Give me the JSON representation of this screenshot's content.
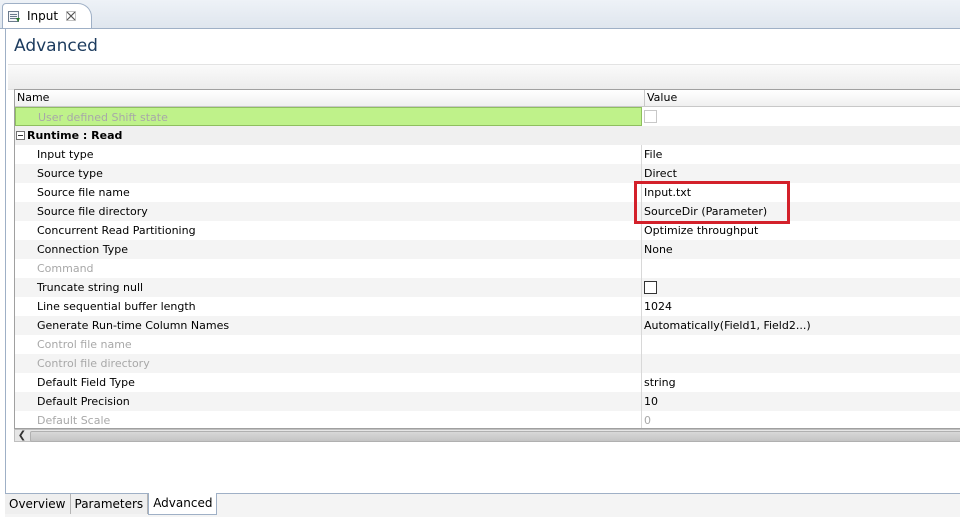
{
  "tab": {
    "label": "Input"
  },
  "page_title": "Advanced",
  "table": {
    "headers": {
      "name": "Name",
      "value": "Value"
    },
    "rows": [
      {
        "kind": "property",
        "name": "User defined Shift state",
        "value": "",
        "checkbox": true,
        "checked": false,
        "disabled": true,
        "highlight": true
      },
      {
        "kind": "category",
        "name": "Runtime : Read"
      },
      {
        "kind": "property",
        "name": "Input type",
        "value": "File"
      },
      {
        "kind": "property",
        "name": "Source type",
        "value": "Direct"
      },
      {
        "kind": "property",
        "name": "Source file name",
        "value": "Input.txt"
      },
      {
        "kind": "property",
        "name": "Source file directory",
        "value": "SourceDir (Parameter)"
      },
      {
        "kind": "property",
        "name": "Concurrent Read Partitioning",
        "value": "Optimize throughput"
      },
      {
        "kind": "property",
        "name": "Connection Type",
        "value": "None"
      },
      {
        "kind": "property",
        "name": "Command",
        "value": "",
        "disabled": true
      },
      {
        "kind": "property",
        "name": "Truncate string null",
        "value": "",
        "checkbox": true,
        "checked": false
      },
      {
        "kind": "property",
        "name": "Line sequential buffer length",
        "value": "1024"
      },
      {
        "kind": "property",
        "name": "Generate Run-time Column Names",
        "value": "Automatically(Field1, Field2...)"
      },
      {
        "kind": "property",
        "name": "Control file name",
        "value": "",
        "disabled": true
      },
      {
        "kind": "property",
        "name": "Control file directory",
        "value": "",
        "disabled": true
      },
      {
        "kind": "property",
        "name": "Default Field Type",
        "value": "string"
      },
      {
        "kind": "property",
        "name": "Default Precision",
        "value": "10"
      },
      {
        "kind": "property",
        "name": "Default Scale",
        "value": "0",
        "disabled": true
      }
    ]
  },
  "bottom_tabs": [
    {
      "label": "Overview",
      "active": false
    },
    {
      "label": "Parameters",
      "active": false
    },
    {
      "label": "Advanced",
      "active": true
    }
  ],
  "colors": {
    "highlight_row": "#bff28a",
    "annotation_box": "#d3202a",
    "title_text": "#1c3b5e"
  },
  "icons": {
    "tab": "input-transformation-icon",
    "close": "close-icon",
    "collapse": "collapse-icon",
    "scroll_left": "scroll-left-arrow-icon"
  }
}
